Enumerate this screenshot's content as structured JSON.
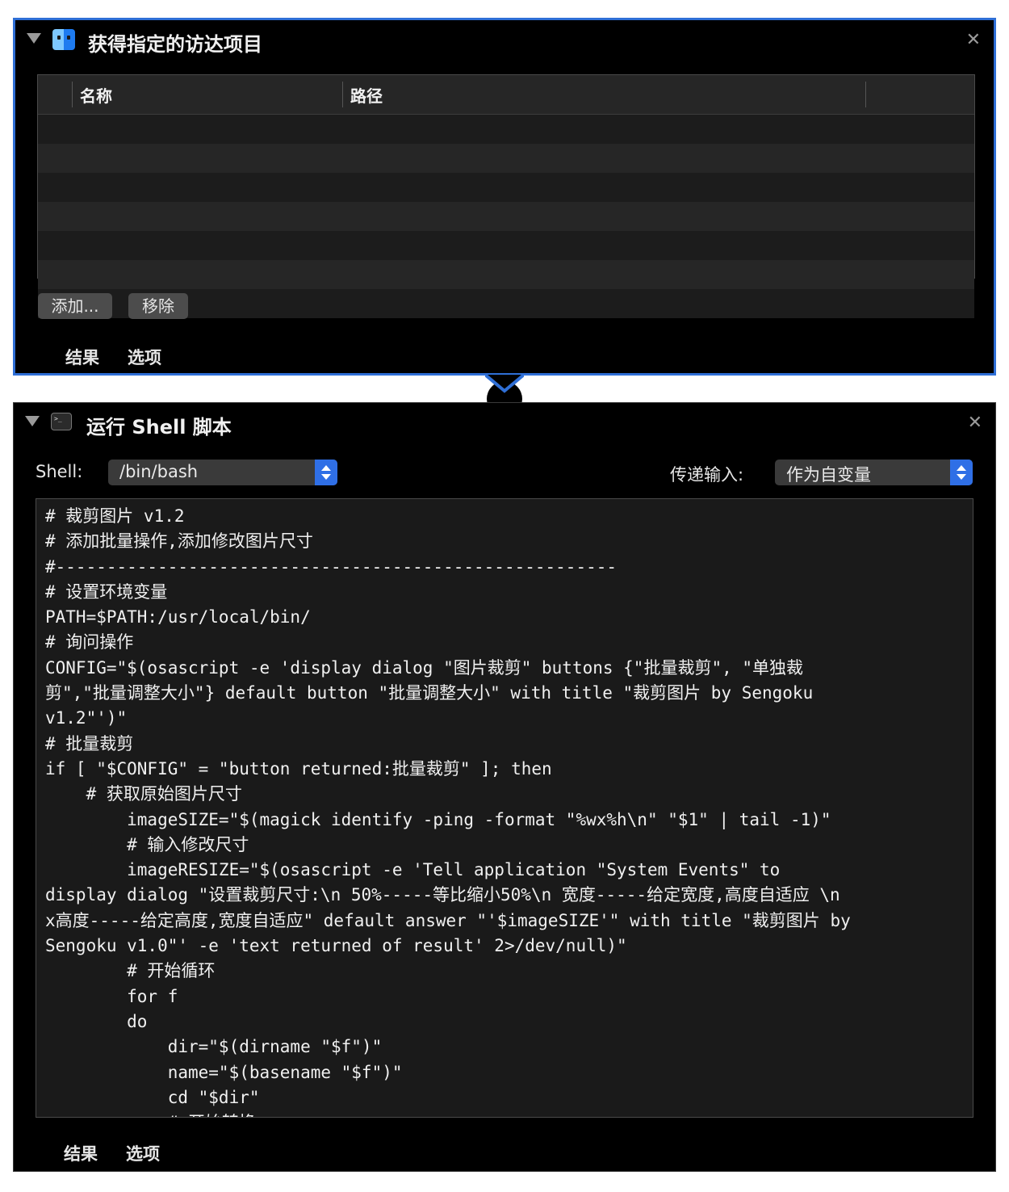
{
  "action1": {
    "title": "获得指定的访达项目",
    "icon": "finder-icon",
    "table": {
      "columns": [
        "名称",
        "路径"
      ],
      "rows": []
    },
    "buttons": {
      "add": "添加...",
      "remove": "移除"
    },
    "tabs": [
      "结果",
      "选项"
    ]
  },
  "action2": {
    "title": "运行 Shell 脚本",
    "icon": "terminal-icon",
    "shell_label": "Shell:",
    "shell_value": "/bin/bash",
    "pass_input_label": "传递输入:",
    "pass_input_value": "作为自变量",
    "code": [
      "# 裁剪图片 v1.2",
      "# 添加批量操作,添加修改图片尺寸",
      "#-------------------------------------------------------",
      "# 设置环境变量",
      "PATH=$PATH:/usr/local/bin/",
      "# 询问操作",
      "CONFIG=\"$(osascript -e 'display dialog \"图片裁剪\" buttons {\"批量裁剪\", \"单独裁",
      "剪\",\"批量调整大小\"} default button \"批量调整大小\" with title \"裁剪图片 by Sengoku",
      "v1.2\"')\"",
      "# 批量裁剪",
      "if [ \"$CONFIG\" = \"button returned:批量裁剪\" ]; then",
      "    # 获取原始图片尺寸",
      "        imageSIZE=\"$(magick identify -ping -format \"%wx%h\\n\" \"$1\" | tail -1)\"",
      "        # 输入修改尺寸",
      "        imageRESIZE=\"$(osascript -e 'Tell application \"System Events\" to",
      "display dialog \"设置裁剪尺寸:\\n 50%-----等比缩小50%\\n 宽度-----给定宽度,高度自适应 \\n",
      "x高度-----给定高度,宽度自适应\" default answer \"'$imageSIZE'\" with title \"裁剪图片 by",
      "Sengoku v1.0\"' -e 'text returned of result' 2>/dev/null)\"",
      "        # 开始循环",
      "        for f",
      "        do",
      "            dir=\"$(dirname \"$f\")\"",
      "            name=\"$(basename \"$f\")\"",
      "            cd \"$dir\"",
      "            # 开始转换"
    ],
    "tabs": [
      "结果",
      "选项"
    ]
  },
  "colors": {
    "accent": "#2f6fd6",
    "panel_bg": "#000000",
    "selector_blue": "#2f6fe6"
  }
}
